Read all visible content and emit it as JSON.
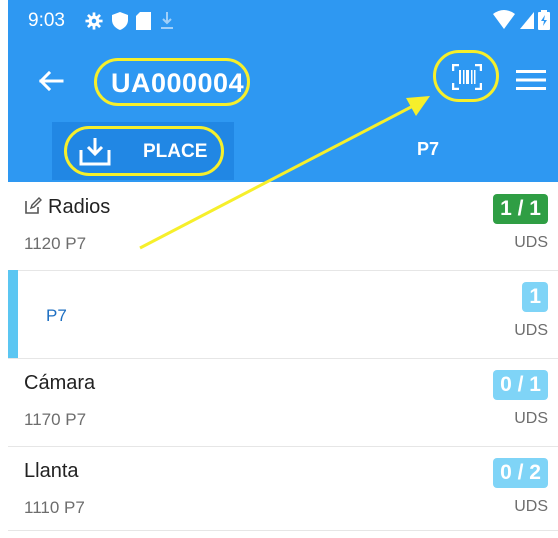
{
  "status_bar": {
    "time": "9:03"
  },
  "app_bar": {
    "title": "UA000004"
  },
  "tabs": {
    "place_label": "PLACE",
    "p7_label": "P7"
  },
  "items": [
    {
      "name": "Radios",
      "code": "1120 P7",
      "badge": "1 / 1",
      "unit": "UDS"
    },
    {
      "location": "P7",
      "badge": "1",
      "unit": "UDS"
    },
    {
      "name": "Cámara",
      "code": "1170 P7",
      "badge": "0 / 1",
      "unit": "UDS"
    },
    {
      "name": "Llanta",
      "code": "1110 P7",
      "badge": "0 / 2",
      "unit": "UDS"
    }
  ],
  "colors": {
    "primary": "#2e98f2",
    "highlight": "#f6ef2b",
    "badge_green": "#2f9e44",
    "badge_light": "#7fd4f7",
    "selection_bar": "#5bc6f2"
  },
  "icons": [
    "gear-icon",
    "shield-icon",
    "sd-card-icon",
    "download-icon",
    "wifi-icon",
    "battery-icon",
    "back-arrow-icon",
    "barcode-scan-icon",
    "menu-icon",
    "place-icon",
    "edit-icon"
  ]
}
